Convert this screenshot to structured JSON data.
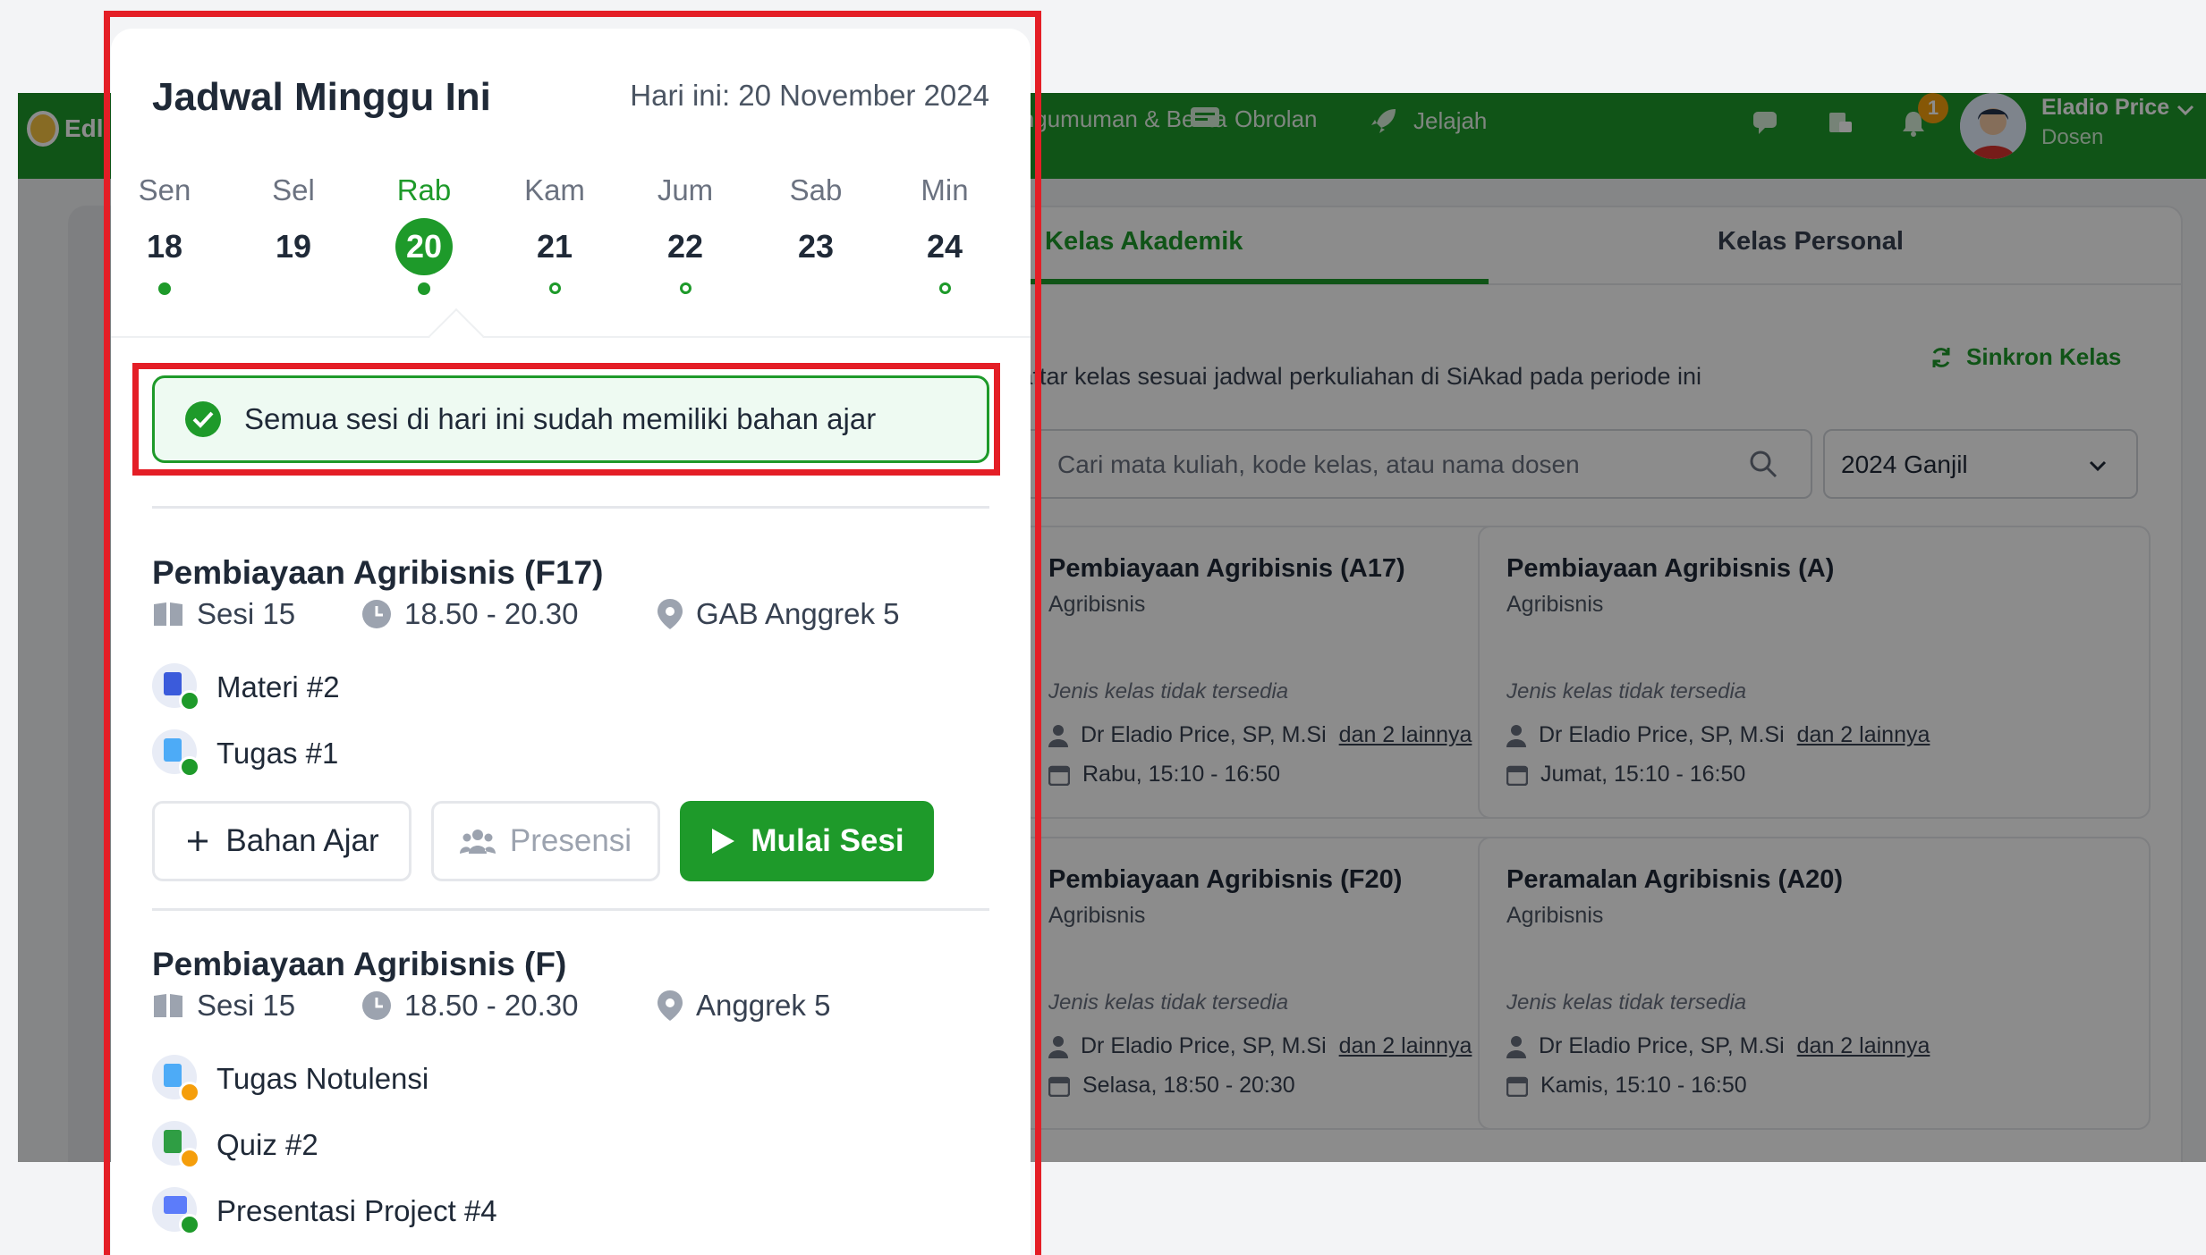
{
  "app": {
    "brand": "Edlink",
    "nav": {
      "news_label": "Pengumuman & Berita",
      "chat_label": "Obrolan",
      "explore_label": "Jelajah"
    },
    "notification_count": "1",
    "user": {
      "name": "Eladio Price",
      "role": "Dosen"
    },
    "colors": {
      "primary": "#1e9a2a",
      "alert_frame": "#e41e26",
      "pending": "#f59e0b"
    }
  },
  "classes_page": {
    "tabs": [
      "Kelas Akademik",
      "Kelas Personal"
    ],
    "active_tab": "Kelas Akademik",
    "sync_label": "Sinkron Kelas",
    "subtitle": "Daftar kelas sesuai jadwal perkuliahan di SiAkad pada periode ini",
    "search_placeholder": "Cari mata kuliah, kode kelas, atau nama dosen",
    "period_select": "2024 Ganjil",
    "cards": [
      {
        "title": "Pembiayaan Agribisnis (A17)",
        "dept": "Agribisnis",
        "type": "Jenis kelas tidak tersedia",
        "lecturer": "Dr Eladio Price, SP, M.Si",
        "more": "dan 2 lainnya",
        "schedule": "Rabu, 15:10 - 16:50"
      },
      {
        "title": "Pembiayaan Agribisnis (A)",
        "dept": "Agribisnis",
        "type": "Jenis kelas tidak tersedia",
        "lecturer": "Dr Eladio Price, SP, M.Si",
        "more": "dan 2 lainnya",
        "schedule": "Jumat, 15:10 - 16:50"
      },
      {
        "title": "Pembiayaan Agribisnis (F20)",
        "dept": "Agribisnis",
        "type": "Jenis kelas tidak tersedia",
        "lecturer": "Dr Eladio Price, SP, M.Si",
        "more": "dan 2 lainnya",
        "schedule": "Selasa, 18:50 - 20:30"
      },
      {
        "title": "Peramalan Agribisnis (A20)",
        "dept": "Agribisnis",
        "type": "Jenis kelas tidak tersedia",
        "lecturer": "Dr Eladio Price, SP, M.Si",
        "more": "dan 2 lainnya",
        "schedule": "Kamis, 15:10 - 16:50"
      }
    ]
  },
  "schedule_popup": {
    "title": "Jadwal Minggu Ini",
    "today_label": "Hari ini: 20 November 2024",
    "days": [
      {
        "name": "Sen",
        "date": "18",
        "dot": "filled",
        "active": false
      },
      {
        "name": "Sel",
        "date": "19",
        "dot": "none",
        "active": false
      },
      {
        "name": "Rab",
        "date": "20",
        "dot": "filled",
        "active": true
      },
      {
        "name": "Kam",
        "date": "21",
        "dot": "empty",
        "active": false
      },
      {
        "name": "Jum",
        "date": "22",
        "dot": "empty",
        "active": false
      },
      {
        "name": "Sab",
        "date": "23",
        "dot": "none",
        "active": false
      },
      {
        "name": "Min",
        "date": "24",
        "dot": "empty",
        "active": false
      }
    ],
    "alert_text": "Semua sesi di hari ini sudah memiliki bahan ajar",
    "sessions": [
      {
        "title": "Pembiayaan Agribisnis (F17)",
        "session": "Sesi 15",
        "time": "18.50 - 20.30",
        "room": "GAB Anggrek 5",
        "materials": [
          {
            "label": "Materi #2",
            "status": "done",
            "icon": "material-doc-icon"
          },
          {
            "label": "Tugas #1",
            "status": "done",
            "icon": "assignment-doc-icon"
          }
        ],
        "buttons": {
          "add_material": "Bahan Ajar",
          "attendance": "Presensi",
          "start": "Mulai Sesi"
        }
      },
      {
        "title": "Pembiayaan Agribisnis (F)",
        "session": "Sesi 15",
        "time": "18.50 - 20.30",
        "room": "Anggrek 5",
        "materials": [
          {
            "label": "Tugas Notulensi",
            "status": "pending",
            "icon": "assignment-doc-icon"
          },
          {
            "label": "Quiz #2",
            "status": "pending",
            "icon": "quiz-icon"
          },
          {
            "label": "Presentasi Project #4",
            "status": "done",
            "icon": "presentation-icon"
          }
        ]
      }
    ]
  }
}
